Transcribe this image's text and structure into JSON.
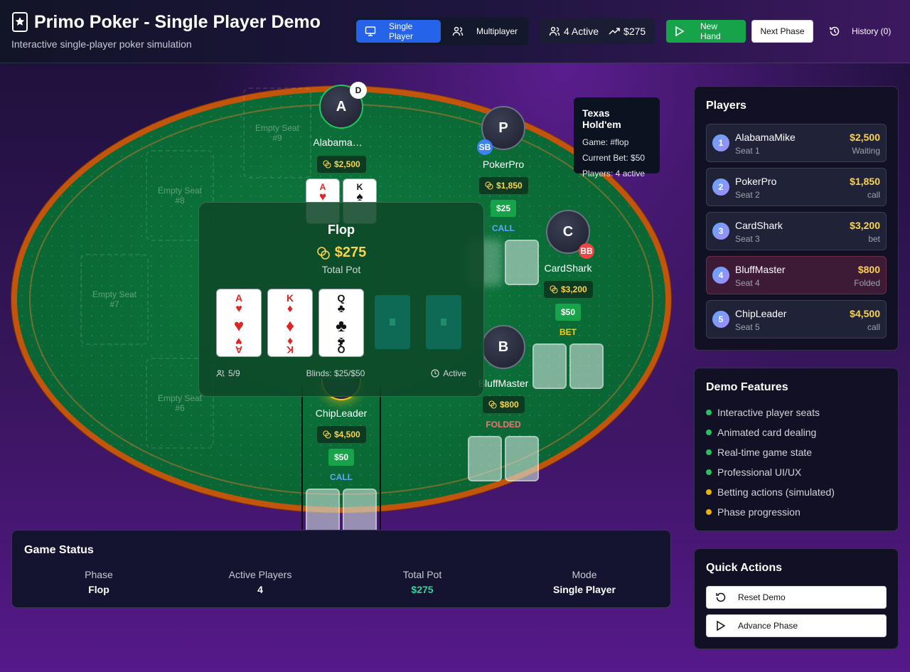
{
  "header": {
    "title": "Primo Poker - Single Player Demo",
    "subtitle": "Interactive single-player poker simulation",
    "mode_single": "Single Player",
    "mode_multi": "Multiplayer",
    "active": "4 Active",
    "pot": "$275",
    "new_hand": "New Hand",
    "next_phase": "Next Phase",
    "history": "History (0)"
  },
  "empty_seats": [
    {
      "label": "Empty Seat",
      "num": "#9"
    },
    {
      "label": "Empty Seat",
      "num": "#8"
    },
    {
      "label": "Empty Seat",
      "num": "#7"
    },
    {
      "label": "Empty Seat",
      "num": "#6"
    }
  ],
  "seats": {
    "alabama": {
      "initial": "A",
      "name": "Alabama…",
      "chips": "$2,500",
      "badge": "D",
      "cards": [
        {
          "rank": "A",
          "suit": "♥"
        },
        {
          "rank": "K",
          "suit": "♠"
        }
      ]
    },
    "pokerpro": {
      "initial": "P",
      "name": "PokerPro",
      "chips": "$1,850",
      "badge": "SB",
      "bet": "$25",
      "action": "CALL"
    },
    "cardshark": {
      "initial": "C",
      "name": "CardShark",
      "chips": "$3,200",
      "badge": "BB",
      "bet": "$50",
      "action": "BET"
    },
    "bluffmaster": {
      "initial": "B",
      "name": "BluffMaster",
      "chips": "$800",
      "action": "FOLDED"
    },
    "chipleader": {
      "name": "ChipLeader",
      "chips": "$4,500",
      "bet": "$50",
      "action": "CALL"
    }
  },
  "center": {
    "phase": "Flop",
    "pot": "$275",
    "pot_label": "Total Pot",
    "community": [
      {
        "rank": "A",
        "suit": "♥",
        "color": "red"
      },
      {
        "rank": "K",
        "suit": "♦",
        "color": "red"
      },
      {
        "rank": "Q",
        "suit": "♣",
        "color": "black"
      }
    ],
    "seats": "5/9",
    "blinds": "Blinds: $25/$50",
    "status": "Active"
  },
  "info": {
    "title": "Texas Hold'em",
    "game": "Game: #flop",
    "bet": "Current Bet: $50",
    "players": "Players: 4 active"
  },
  "game_status": {
    "title": "Game Status",
    "phase_l": "Phase",
    "phase_v": "Flop",
    "active_l": "Active Players",
    "active_v": "4",
    "pot_l": "Total Pot",
    "pot_v": "$275",
    "mode_l": "Mode",
    "mode_v": "Single Player"
  },
  "players": {
    "title": "Players",
    "list": [
      {
        "num": "1",
        "name": "AlabamaMike",
        "seat": "Seat 1",
        "amount": "$2,500",
        "status": "Waiting"
      },
      {
        "num": "2",
        "name": "PokerPro",
        "seat": "Seat 2",
        "amount": "$1,850",
        "status": "call"
      },
      {
        "num": "3",
        "name": "CardShark",
        "seat": "Seat 3",
        "amount": "$3,200",
        "status": "bet"
      },
      {
        "num": "4",
        "name": "BluffMaster",
        "seat": "Seat 4",
        "amount": "$800",
        "status": "Folded"
      },
      {
        "num": "5",
        "name": "ChipLeader",
        "seat": "Seat 5",
        "amount": "$4,500",
        "status": "call"
      }
    ]
  },
  "features": {
    "title": "Demo Features",
    "list": [
      {
        "text": "Interactive player seats",
        "color": "#22c55e"
      },
      {
        "text": "Animated card dealing",
        "color": "#22c55e"
      },
      {
        "text": "Real-time game state",
        "color": "#22c55e"
      },
      {
        "text": "Professional UI/UX",
        "color": "#22c55e"
      },
      {
        "text": "Betting actions (simulated)",
        "color": "#eab308"
      },
      {
        "text": "Phase progression",
        "color": "#eab308"
      }
    ]
  },
  "quick": {
    "title": "Quick Actions",
    "reset": "Reset Demo",
    "advance": "Advance Phase"
  }
}
